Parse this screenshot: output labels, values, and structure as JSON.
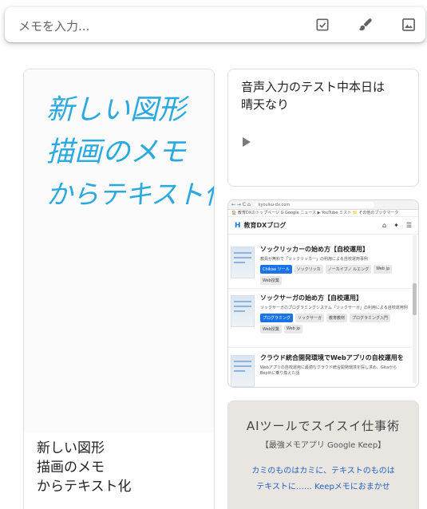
{
  "note_bar": {
    "placeholder": "メモを入力...",
    "icons": [
      "checkbox-icon",
      "brush-icon",
      "image-icon"
    ]
  },
  "notes": {
    "drawing": {
      "handwriting_lines": [
        "新しい図形",
        "描画のメモ",
        "からテキスト化"
      ],
      "handwriting_color": "#29a9e0",
      "text": "新しい図形\n描画のメモ\nからテキスト化"
    },
    "voice": {
      "text": "音声入力のテスト中本日は\n晴天なり"
    },
    "screenshot": {
      "address": "kyouiku-dx.com",
      "bookmarks": "🏠 教育DXのトップページ   G Google ニュース   ▶ YouTube ミスト      📁 その他のブックマーク",
      "site_name": "教育DXブログ",
      "articles": [
        {
          "title": "ソックリッカーの始め方【自校運用】",
          "desc": "教員が無料で「ソックリッカー」の利用による自校運用事例",
          "tags": [
            "Chikaa ツール",
            "ソックリッカ",
            "ノーカイブノ ルエング",
            "Web jp",
            "Web授業"
          ]
        },
        {
          "title": "ソックサーガの始め方【自校運用】",
          "desc": "ソックサーガのプログラミングシステム「ソックサーガ」の利用による自校運用例",
          "tags": [
            "プログラミング",
            "ソックサーガ",
            "教育教材",
            "プログラミング入門",
            "Web授業",
            "Web jp"
          ]
        },
        {
          "title": "クラウド統合開発環境でWebアプリの自校運用を",
          "desc": "Webアプリの自校運用に最適なクラウド統合開発環境を探し求め、GitaからReplitに乗り換えた話",
          "tags": []
        }
      ]
    },
    "photo": {
      "lines": [
        "AIツールでスイスイ仕事術",
        "【最強メモアプリ Google Keep】",
        "カミのものはカミに、テキストのものは",
        "テキストに…… Keepメモにおまかせ"
      ]
    }
  },
  "colors": {
    "accent": "#1a73e8",
    "text": "#202124",
    "muted": "#5f6368",
    "border": "#e0e0e0"
  }
}
